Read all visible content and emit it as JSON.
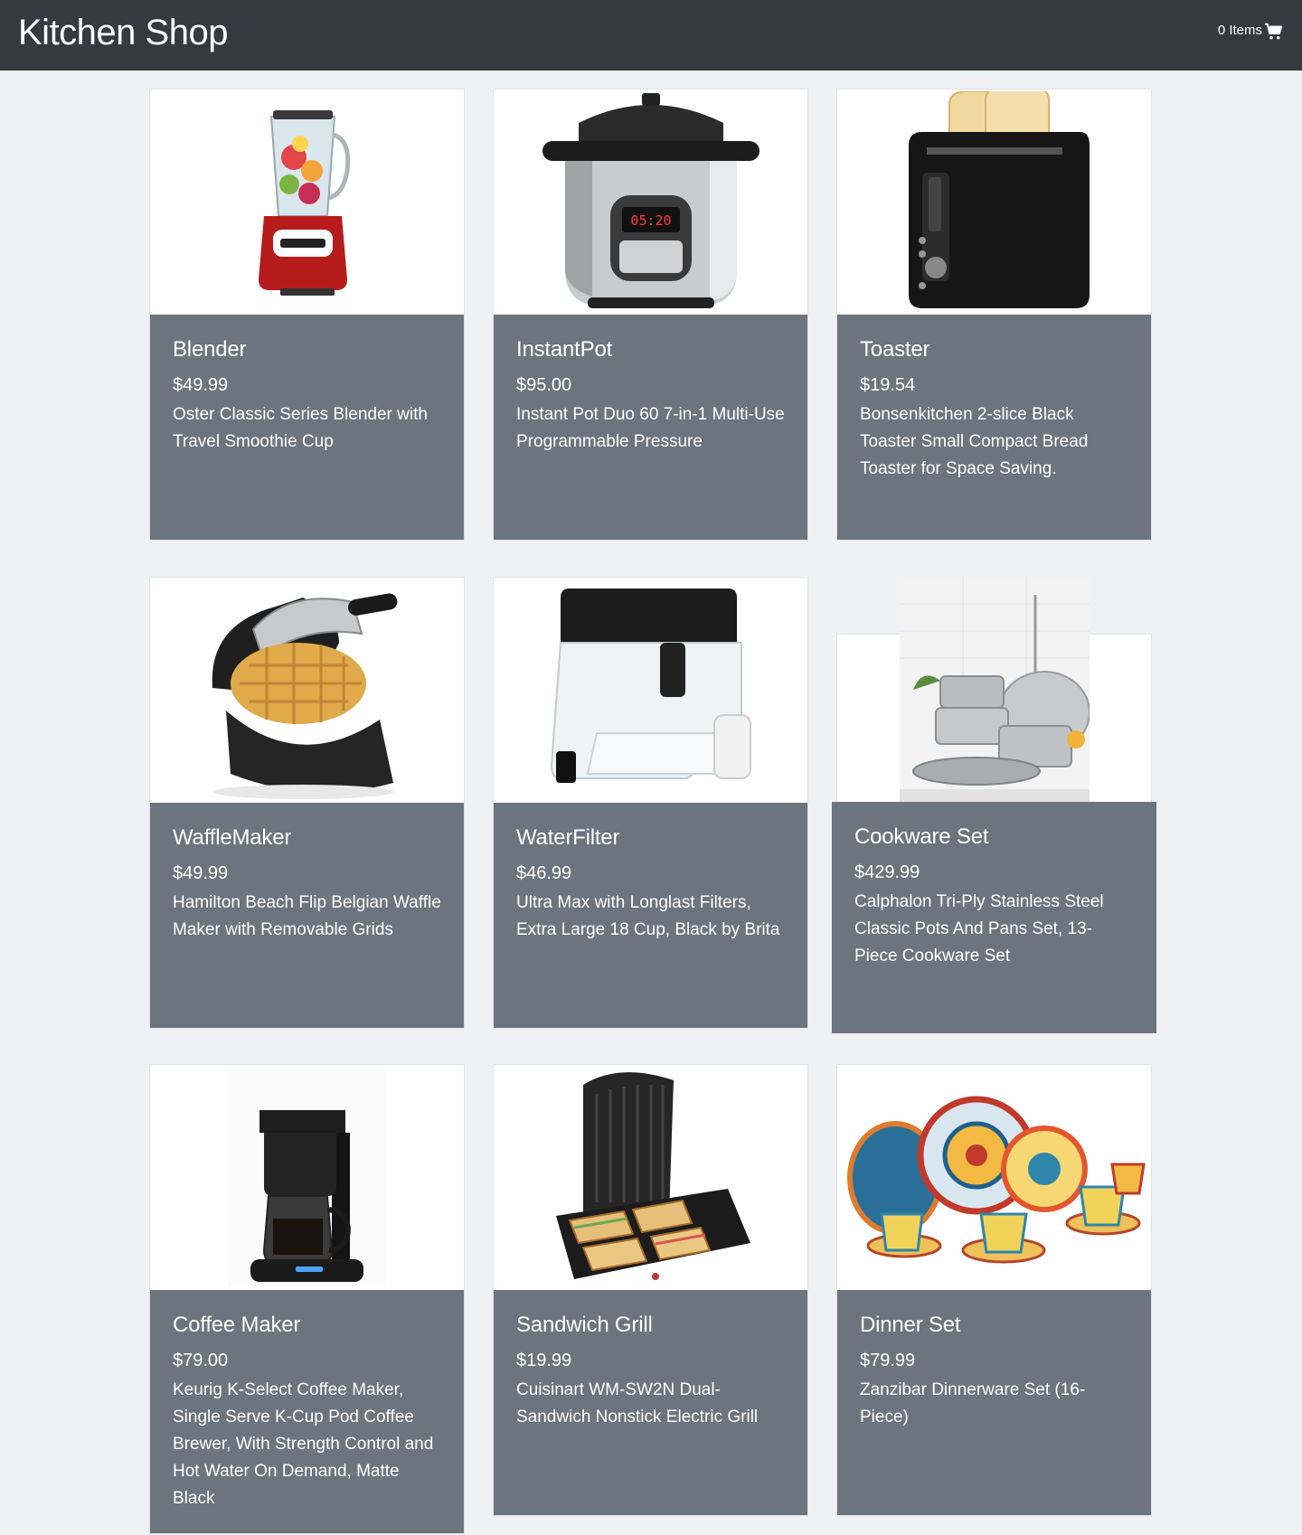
{
  "header": {
    "brand": "Kitchen Shop",
    "cart_label": "0 Items",
    "cart_icon": "shopping-cart-icon"
  },
  "products": [
    {
      "name": "Blender",
      "price": "$49.99",
      "description": "Oster Classic Series Blender with Travel Smoothie Cup",
      "image_icon": "blender-image"
    },
    {
      "name": "InstantPot",
      "price": "$95.00",
      "description": "Instant Pot Duo 60 7-in-1 Multi-Use Programmable Pressure",
      "image_icon": "instant-pot-image",
      "image_text": "05:20"
    },
    {
      "name": "Toaster",
      "price": "$19.54",
      "description": "Bonsenkitchen 2-slice Black Toaster Small Compact Bread Toaster for Space Saving.",
      "image_icon": "toaster-image"
    },
    {
      "name": "WaffleMaker",
      "price": "$49.99",
      "description": "Hamilton Beach Flip Belgian Waffle Maker with Removable Grids",
      "image_icon": "waffle-maker-image"
    },
    {
      "name": "WaterFilter",
      "price": "$46.99",
      "description": "Ultra Max with Longlast Filters, Extra Large 18 Cup, Black by Brita",
      "image_icon": "water-filter-image"
    },
    {
      "name": "Cookware Set",
      "price": "$429.99",
      "description": "Calphalon Tri-Ply Stainless Steel Classic Pots And Pans Set, 13-Piece Cookware Set",
      "image_icon": "cookware-image"
    },
    {
      "name": "Coffee Maker",
      "price": "$79.00",
      "description": "Keurig K-Select Coffee Maker, Single Serve K-Cup Pod Coffee Brewer, With Strength Control and Hot Water On Demand, Matte Black",
      "image_icon": "coffee-maker-image"
    },
    {
      "name": "Sandwich Grill",
      "price": "$19.99",
      "description": "Cuisinart WM-SW2N Dual-Sandwich Nonstick Electric Grill",
      "image_icon": "sandwich-grill-image"
    },
    {
      "name": "Dinner Set",
      "price": "$79.99",
      "description": "Zanzibar Dinnerware Set (16-Piece)",
      "image_icon": "dinner-set-image"
    }
  ],
  "colors": {
    "navbar": "#343a40",
    "card_body": "#6c757d",
    "page_bg": "#f0f1f4"
  }
}
